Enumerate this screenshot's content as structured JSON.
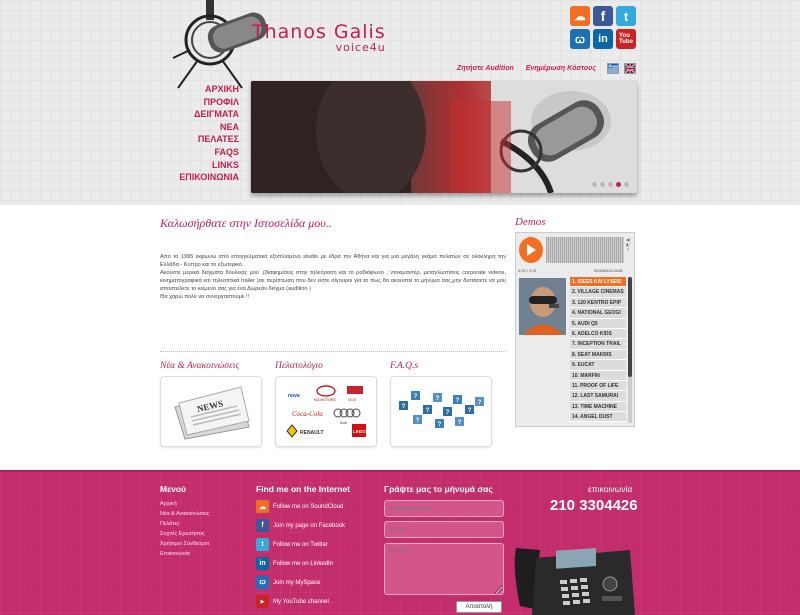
{
  "brand": {
    "name": "Thanos Galis",
    "subtitle": "voice4u"
  },
  "social_icons": [
    "soundcloud-icon",
    "facebook-icon",
    "twitter-icon",
    "myspace-icon",
    "linkedin-icon",
    "youtube-icon"
  ],
  "top_links": [
    "Ζητήστε Audition",
    "Ενημέρωση Κόστους"
  ],
  "languages": [
    "greek-flag-icon",
    "uk-flag-icon"
  ],
  "nav": [
    "ΑΡΧΙΚΗ",
    "ΠΡΟΦΙΛ",
    "ΔΕΙΓΜΑΤΑ",
    "ΝΕΑ",
    "ΠΕΛΑΤΕΣ",
    "FAQs",
    "LINKS",
    "ΕΠΙΚΟΙΝΩΝΙΑ"
  ],
  "slider": {
    "dots": 5,
    "active_dot": 4
  },
  "main": {
    "welcome": "Καλωσήρθατε στην Ιστοσελίδα μου..",
    "intro": [
      "Από το 1995 εκφωνώ από επαγγελματικά εξοπλισμένο studio με έδρα την Αθήνα και για μια μεγάλη γκάμα πελατών σε ολόκληρη την Ελλάδα - Κύπρο και το εξωτερικό.",
      "Ακούστε μερικά δείγματα δουλειάς μου ,(διαφημίσεις στην τηλεόραση και το ραδιόφωνο , ντοκιμαντέρ, μεταγλωττίσεις corporate videos, κινηματογραφικά και τηλεοπτικά trailer )σε περίπτωση που δεν είστε σίγουροι για το πως θα ακουστεί το μήνυμα σας,μην διστάσετε να μου αποστείλετε το κείμενο σας για ένα Δωρεάν δείγμα (audition )",
      "Θα χαρώ πολύ να συνεργαστούμε !!"
    ],
    "sections": [
      {
        "title": "Νέα & Ανακοινώσεις",
        "image": "newspaper-image"
      },
      {
        "title": "Πελατολόγιο",
        "image": "client-logos-image"
      },
      {
        "title": "F.A.Q.s",
        "image": "question-cubes-image"
      }
    ],
    "client_logos": [
      "nova",
      "KIA MOTORS",
      "SEAT",
      "Coca-Cola",
      "Audi",
      "RENAULT",
      "LEGO"
    ],
    "newspaper_text": "NEWS"
  },
  "demos": {
    "title": "Demos",
    "time": "0:00 / 0:21",
    "provider": "SOUNDCLOUD",
    "tracks": [
      "1. IDEES KAI LYSEIS",
      "2. VILLAGE CINEMAS",
      "3. 120 KENTRO EPIP",
      "4. NATIONAL GEOGI",
      "5. AUDI Q5",
      "6. ADELCO KIDS",
      "7. INCEPTION TRAIL",
      "8. SEAT MAKRIS",
      "9. EUCAT",
      "10. MARFIN",
      "11. PROOF OF LIFE",
      "12. LAST SAMURAI",
      "13. TIME MACHINE",
      "14. ANGEL DUST",
      "15. PEGEUOT"
    ]
  },
  "footer": {
    "menu_title": "Μενού",
    "menu": [
      "Αρχική",
      "Νέα & Ανακοινώσεις",
      "Πελάτες",
      "Συχνές Ερωτήσεις",
      "Χρήσιμοι Σύνδεσμοι",
      "Επικοινωνία"
    ],
    "internet_title": "Find me on the Internet",
    "links": [
      {
        "label": "Follow me on SoundCloud",
        "icon": "soundcloud-icon",
        "color": "#f26f21",
        "glyph": "☁"
      },
      {
        "label": "Join my page on Facebook",
        "icon": "facebook-icon",
        "color": "#3b5998",
        "glyph": "f"
      },
      {
        "label": "Follow me on Twitter",
        "icon": "twitter-icon",
        "color": "#33a9dd",
        "glyph": "t"
      },
      {
        "label": "Follow me on LinkedIn",
        "icon": "linkedin-icon",
        "color": "#0a66a8",
        "glyph": "in"
      },
      {
        "label": "Join my MySpace",
        "icon": "myspace-icon",
        "color": "#1f6fb5",
        "glyph": "ꞷ"
      },
      {
        "label": "My YouTube channel",
        "icon": "youtube-icon",
        "color": "#cc2222",
        "glyph": "▶"
      }
    ],
    "form_title": "Γράψτε μας το μήνυμά σας",
    "placeholders": {
      "name": "ονοματεπώνυμο",
      "email": "e-mail",
      "message": "μήνυμα"
    },
    "send": "Αποστολή",
    "contact_label": "επικοινωνία",
    "phone": "210 3304426"
  },
  "colors": {
    "accent": "#c0204c",
    "footer": "#c42d6c",
    "soundcloud": "#f26f21"
  }
}
